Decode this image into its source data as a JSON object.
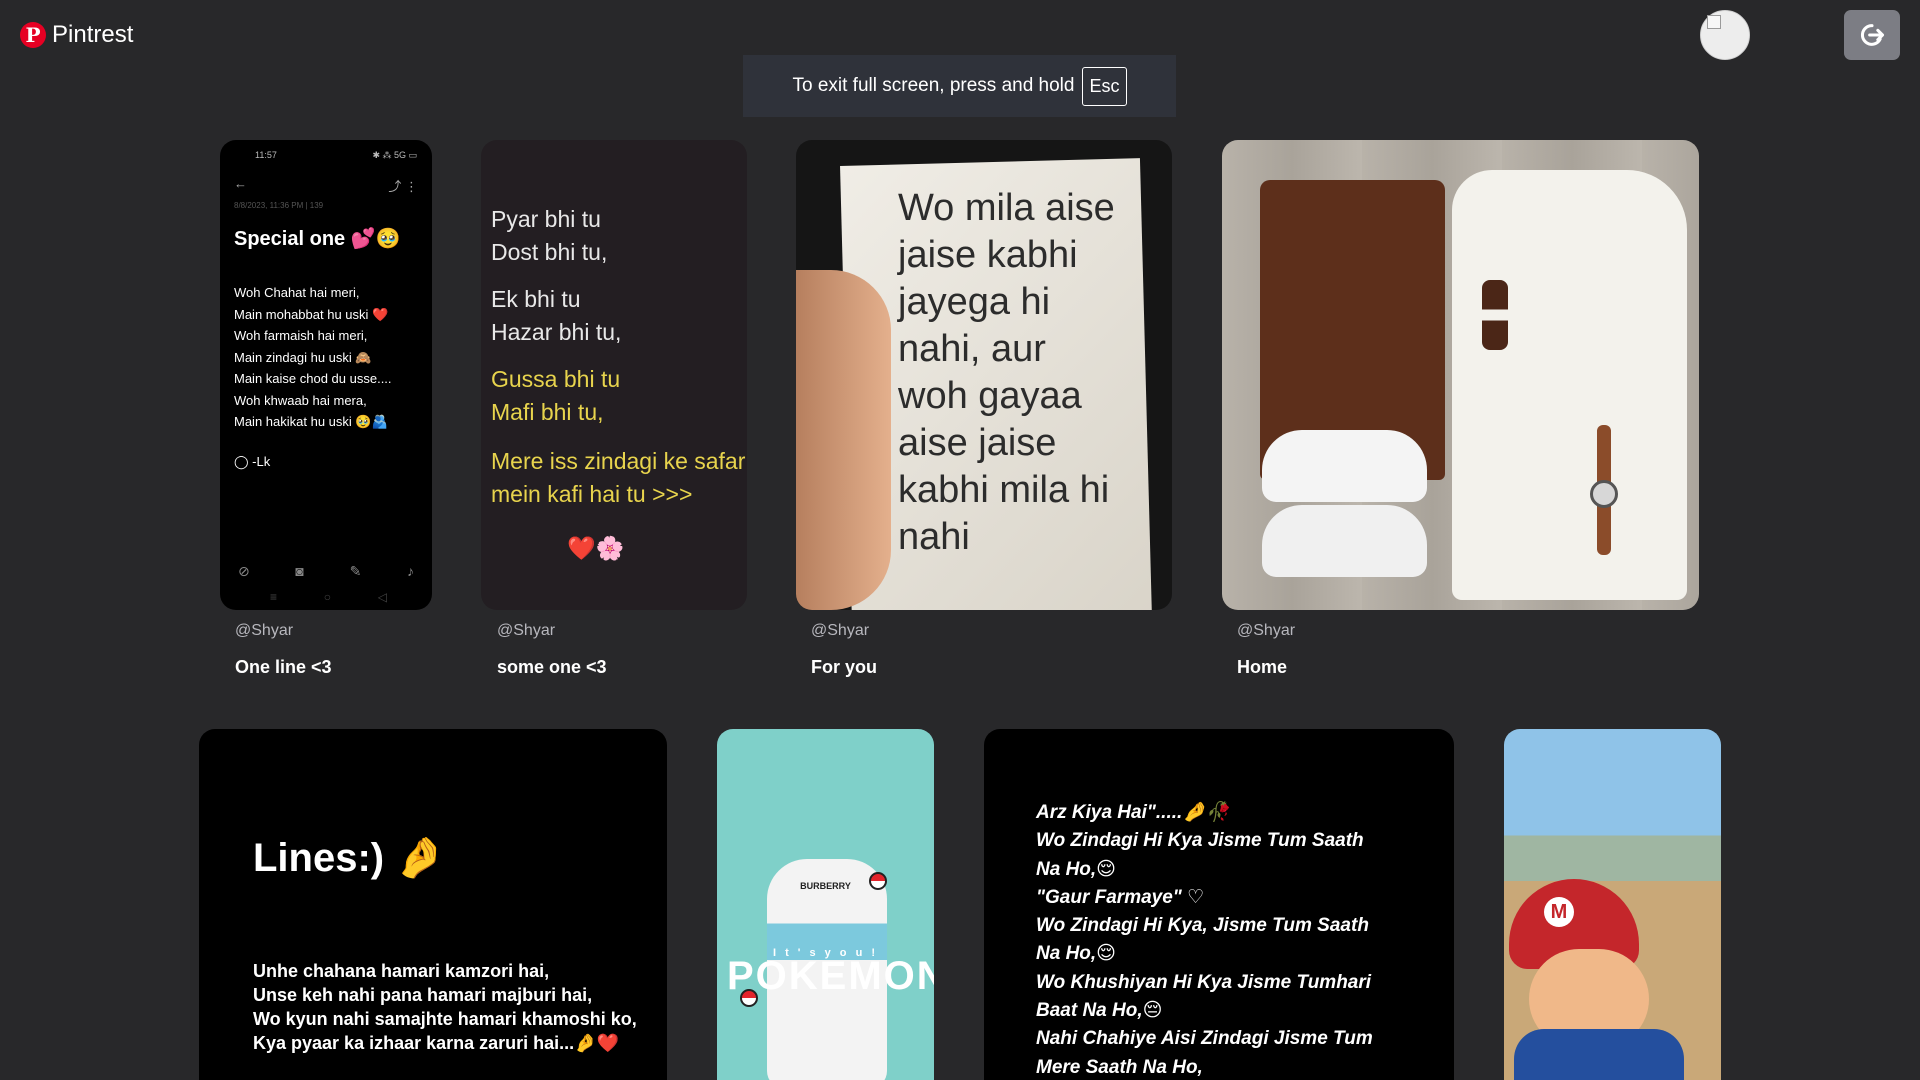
{
  "header": {
    "logo_mark": "P",
    "brand": "Pintrest",
    "logout_icon": "logout-icon",
    "avatar_icon": "broken-image-icon"
  },
  "fullscreen_banner": {
    "message": "To exit full screen, press and hold",
    "key": "Esc"
  },
  "pins": [
    {
      "user": "@Shyar",
      "title": "One line <3",
      "image": {
        "status_time": "11:57",
        "status_icons": "✱ ⁂ 5G ▭",
        "back_icon": "←",
        "actions": "⤴  ⋮",
        "meta": "8/8/2023, 11:36 PM | 139",
        "heading": "Special one 💕🥹",
        "lines": "Woh Chahat hai meri,\nMain mohabbat hu uski ❤️\nWoh farmaish hai meri,\nMain zindagi hu uski 🙈\nMain kaise chod du usse....\nWoh khwaab hai mera,\nMain hakikat hu uski 🥹🫂",
        "signature": "◯ -Lk",
        "tools": [
          "⊘",
          "◙",
          "✎",
          "♪"
        ],
        "nav": [
          "≡",
          "○",
          "◁"
        ]
      }
    },
    {
      "user": "@Shyar",
      "title": "some one <3",
      "image": {
        "l1": "Pyar bhi tu\nDost bhi tu,",
        "l2": "Ek bhi tu\nHazar bhi tu,",
        "l3": "Gussa bhi tu\nMafi bhi tu,",
        "l4": "Mere iss zindagi ke safar\nmein kafi hai tu >>>",
        "l5": "❤️🌸"
      }
    },
    {
      "user": "@Shyar",
      "title": "For you",
      "image": {
        "text": "Wo mila aise\njaise kabhi\njayega hi\nnahi, aur\nwoh gayaa\naise jaise\nkabhi mila hi\nnahi"
      }
    },
    {
      "user": "@Shyar",
      "title": "Home",
      "image": {}
    }
  ],
  "row2": [
    {
      "heading": "Lines:) 🤌",
      "text": "Unhe chahana hamari kamzori hai,\nUnse keh nahi pana hamari majburi hai,\nWo kyun nahi samajhte hamari khamoshi ko,\nKya pyaar ka izhaar karna zaruri hai...🤌❤️"
    },
    {
      "hat_label": "BURBERRY",
      "tagline": "I t ' s    y o u !",
      "big": "POKEMON"
    },
    {
      "text": "Arz Kiya Hai\".....🤌🥀\nWo Zindagi Hi Kya Jisme Tum Saath\nNa Ho,😌\n\"Gaur Farmaye\" ♡\nWo Zindagi Hi Kya, Jisme Tum Saath\nNa Ho,😌\nWo Khushiyan Hi Kya Jisme Tumhari\nBaat Na Ho,😔\nNahi Chahiye Aisi Zindagi Jisme Tum\nMere Saath Na Ho,"
    },
    {
      "emblem": "M"
    }
  ],
  "colors": {
    "background": "#28282a",
    "brand_red": "#e60023",
    "poem_yellow": "#e8d44d"
  }
}
